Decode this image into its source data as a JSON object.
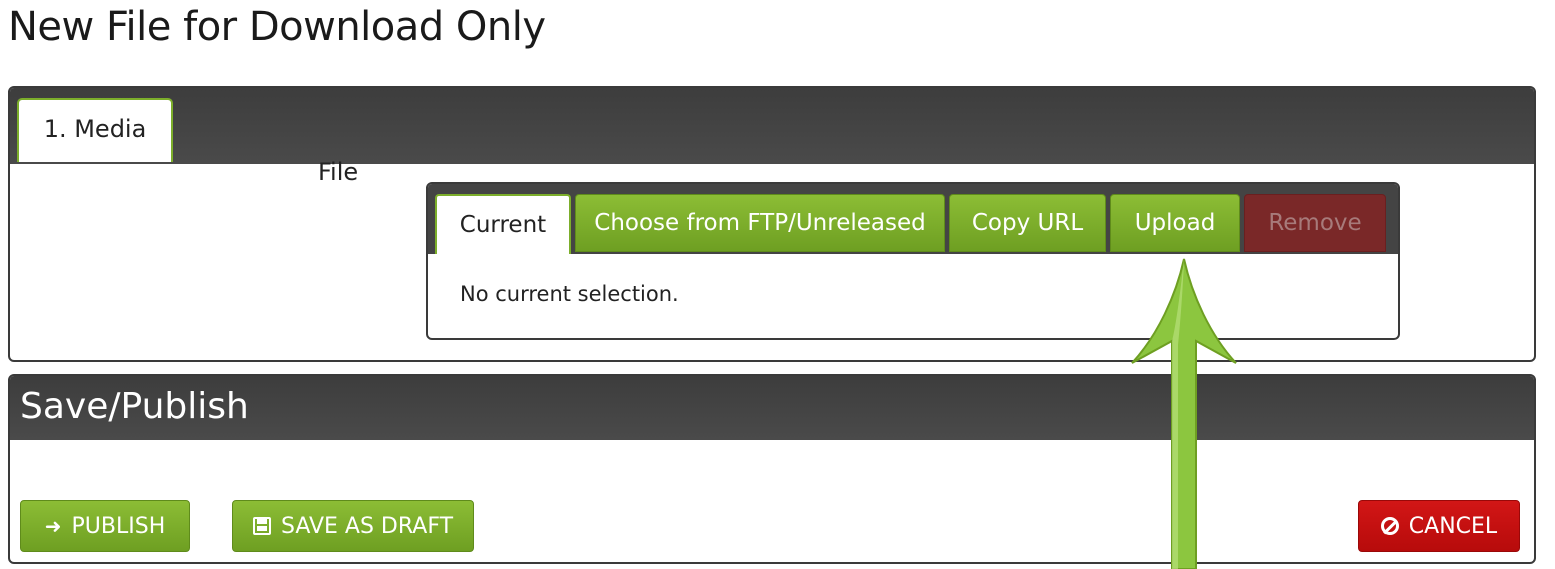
{
  "page": {
    "title": "New File for Download Only"
  },
  "media_panel": {
    "tab_label": "1. Media",
    "file_label": "File",
    "file_widget": {
      "tabs": {
        "current": "Current",
        "ftp": "Choose from FTP/Unreleased",
        "copy_url": "Copy URL",
        "upload": "Upload",
        "remove": "Remove"
      },
      "current_text": "No current selection."
    }
  },
  "save_panel": {
    "title": "Save/Publish",
    "publish_label": "PUBLISH",
    "draft_label": "SAVE AS DRAFT",
    "cancel_label": "CANCEL"
  },
  "icons": {
    "publish": "arrow-right-icon",
    "draft": "floppy-disk-icon",
    "cancel": "ban-icon",
    "annotation": "green-arrow-up-icon"
  },
  "colors": {
    "accent_green": "#7cae2b",
    "danger_red": "#c81010",
    "panel_dark": "#444444",
    "remove_disabled": "#7a2828"
  }
}
